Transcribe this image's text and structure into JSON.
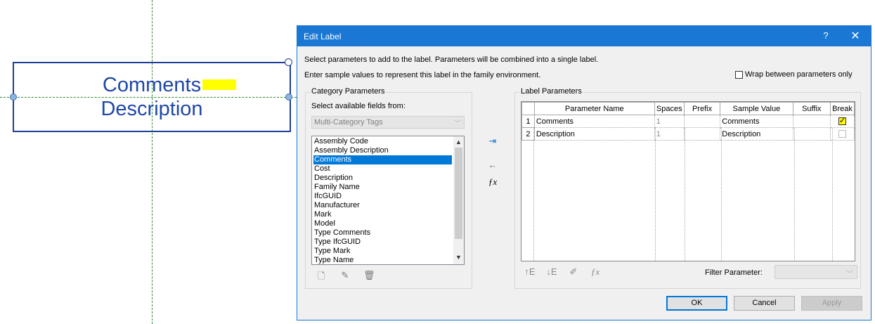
{
  "canvas": {
    "label_lines": [
      "Comments",
      "Description"
    ]
  },
  "dialog": {
    "title": "Edit Label",
    "help": "?",
    "close": "✕",
    "intro_line1": "Select parameters to add to the label.  Parameters will be combined into a single label.",
    "intro_line2": "Enter sample values to represent this label in the family environment.",
    "wrap_label": "Wrap between parameters only",
    "category": {
      "title": "Category Parameters",
      "select_label": "Select available fields from:",
      "combo_value": "Multi-Category Tags",
      "fields": [
        "Assembly Code",
        "Assembly Description",
        "Comments",
        "Cost",
        "Description",
        "Family Name",
        "IfcGUID",
        "Manufacturer",
        "Mark",
        "Model",
        "Type Comments",
        "Type IfcGUID",
        "Type Mark",
        "Type Name"
      ],
      "selected_field": "Comments"
    },
    "label_params": {
      "title": "Label Parameters",
      "columns": [
        "Parameter Name",
        "Spaces",
        "Prefix",
        "Sample Value",
        "Suffix",
        "Break"
      ],
      "rows": [
        {
          "num": "1",
          "name": "Comments",
          "spaces": "1",
          "prefix": "",
          "sample": "Comments",
          "suffix": "",
          "break": true
        },
        {
          "num": "2",
          "name": "Description",
          "spaces": "1",
          "prefix": "",
          "sample": "Description",
          "suffix": "",
          "break": false
        }
      ],
      "filter_label": "Filter Parameter:"
    },
    "buttons": {
      "ok": "OK",
      "cancel": "Cancel",
      "apply": "Apply"
    },
    "icons": {
      "add_parameter": "add-to-label-icon",
      "remove_parameter": "remove-from-label-icon",
      "calculated": "fx-icon"
    }
  }
}
